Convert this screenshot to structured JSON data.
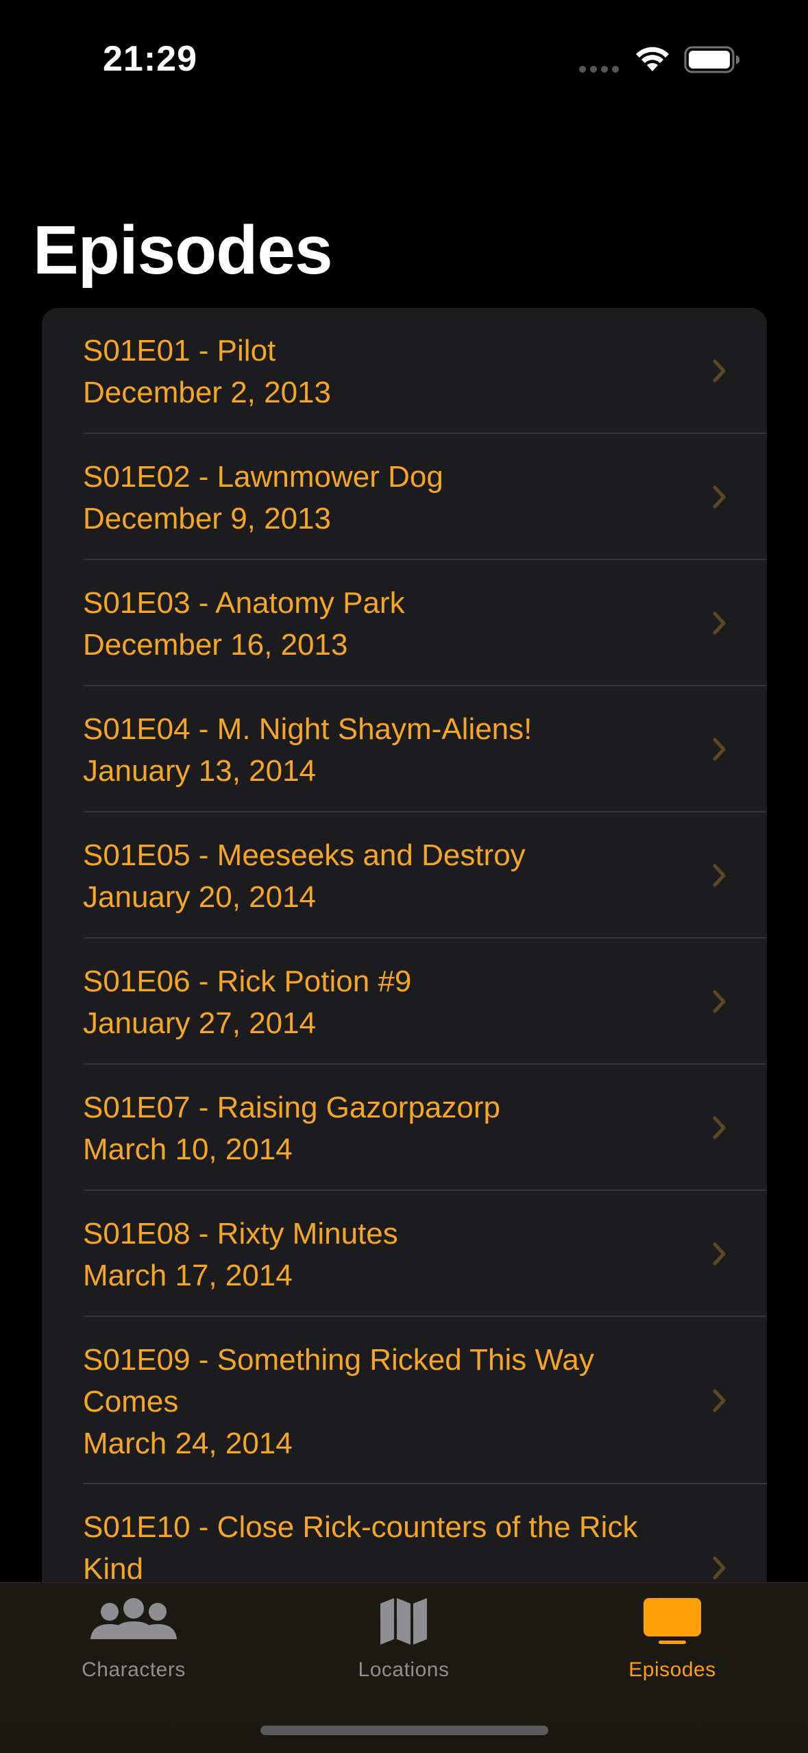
{
  "status_bar": {
    "time": "21:29",
    "icons": [
      "cellular-signal-icon",
      "wifi-icon",
      "battery-icon"
    ]
  },
  "header": {
    "title": "Episodes"
  },
  "episodes": [
    {
      "title": "S01E01 - Pilot",
      "title_line2": "",
      "date": "December 2, 2013"
    },
    {
      "title": "S01E02 - Lawnmower Dog",
      "title_line2": "",
      "date": "December 9, 2013"
    },
    {
      "title": "S01E03 - Anatomy Park",
      "title_line2": "",
      "date": "December 16, 2013"
    },
    {
      "title": "S01E04 - M. Night Shaym-Aliens!",
      "title_line2": "",
      "date": "January 13, 2014"
    },
    {
      "title": "S01E05 - Meeseeks and Destroy",
      "title_line2": "",
      "date": "January 20, 2014"
    },
    {
      "title": "S01E06 - Rick Potion #9",
      "title_line2": "",
      "date": "January 27, 2014"
    },
    {
      "title": "S01E07 - Raising Gazorpazorp",
      "title_line2": "",
      "date": "March 10, 2014"
    },
    {
      "title": "S01E08 - Rixty Minutes",
      "title_line2": "",
      "date": "March 17, 2014"
    },
    {
      "title": "S01E09 - Something Ricked This Way",
      "title_line2": "Comes",
      "date": "March 24, 2014"
    },
    {
      "title": "S01E10 - Close Rick-counters of the Rick",
      "title_line2": "Kind",
      "date": ""
    }
  ],
  "tab_bar": {
    "tabs": [
      {
        "label": "Characters",
        "icon": "people-icon",
        "selected": false
      },
      {
        "label": "Locations",
        "icon": "map-icon",
        "selected": false
      },
      {
        "label": "Episodes",
        "icon": "tv-icon",
        "selected": true
      }
    ]
  },
  "colors": {
    "accent": "#f5a623",
    "background": "#000000",
    "card": "#1c1c1e",
    "separator": "#38383a",
    "tab_inactive": "#8e8e93",
    "tab_active": "#ff9f0a"
  }
}
